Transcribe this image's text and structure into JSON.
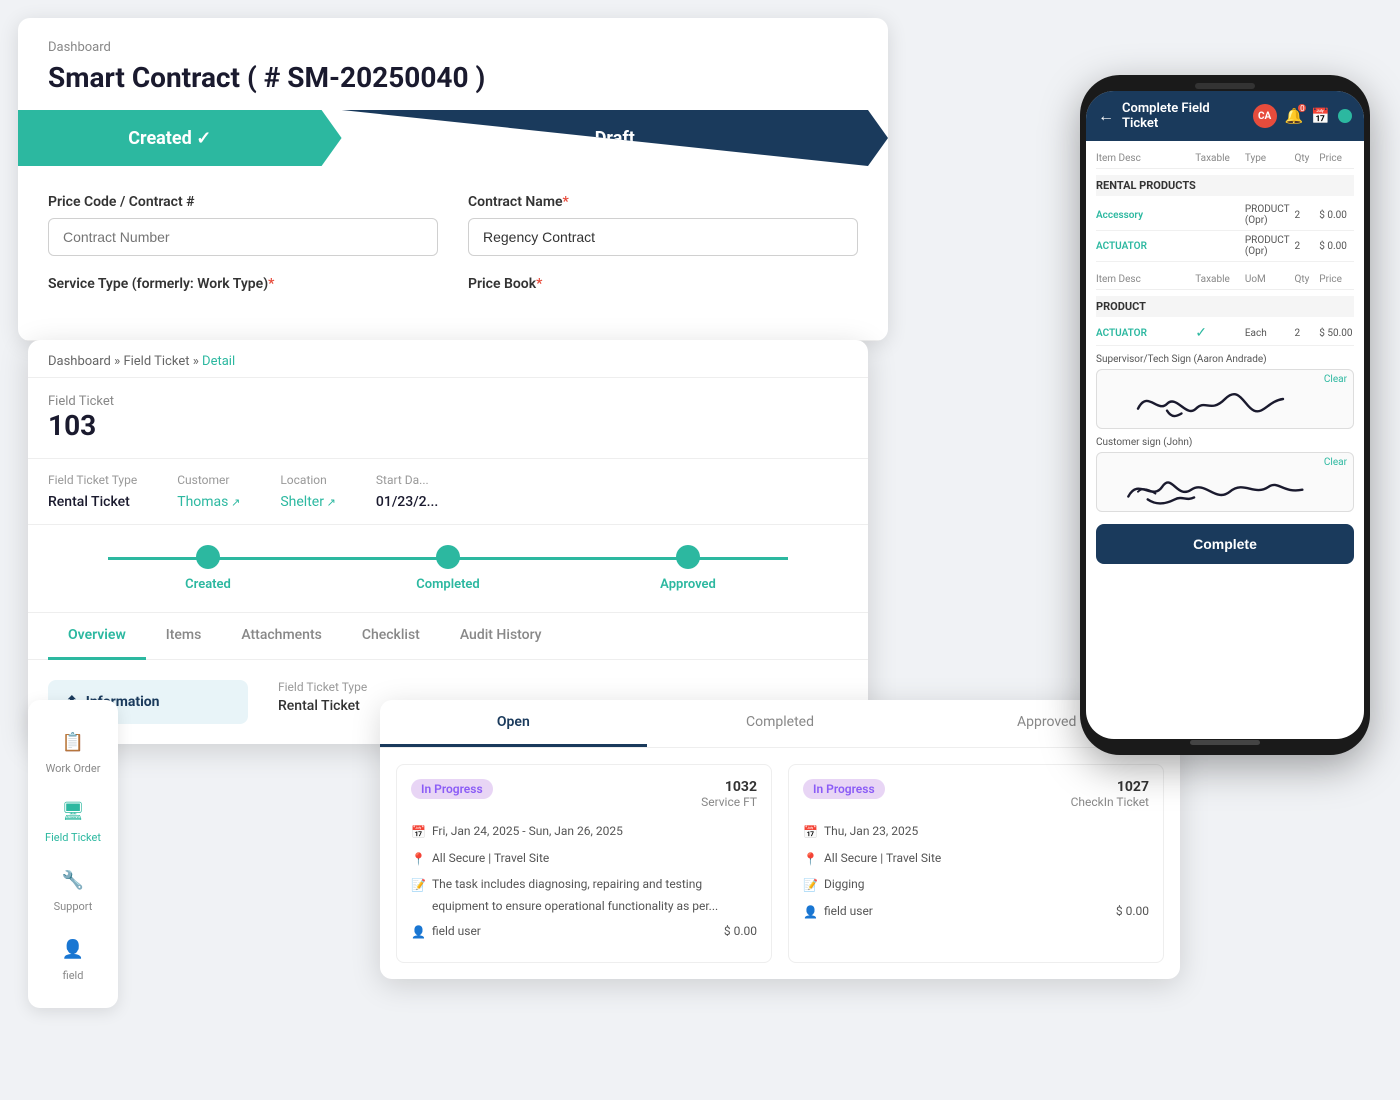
{
  "breadcrumb": "Dashboard",
  "page_title": "Smart Contract ( # SM-20250040 )",
  "status_bar": {
    "created_label": "Created ✓",
    "draft_label": "Draft"
  },
  "form": {
    "price_code_label": "Price Code / Contract #",
    "contract_number_placeholder": "Contract Number",
    "contract_name_label": "Contract Name",
    "contract_name_value": "Regency Contract",
    "service_type_label": "Service Type (formerly: Work Type)",
    "price_book_label": "Price Book"
  },
  "field_ticket": {
    "breadcrumb_dashboard": "Dashboard",
    "breadcrumb_field_ticket": "Field Ticket",
    "breadcrumb_detail": "Detail",
    "label": "Field Ticket",
    "number": "103",
    "type_label": "Field Ticket Type",
    "type_value": "Rental Ticket",
    "customer_label": "Customer",
    "customer_value": "Thomas",
    "location_label": "Location",
    "location_value": "Shelter",
    "start_date_label": "Start Da...",
    "start_date_value": "01/23/2...",
    "progress_steps": [
      "Created",
      "Completed",
      "Approved"
    ],
    "tabs": [
      "Overview",
      "Items",
      "Attachments",
      "Checklist",
      "Audit History"
    ]
  },
  "info_section": {
    "title": "Information",
    "field_ticket_type_label": "Field Ticket Type",
    "field_ticket_type_value": "Rental Ticket"
  },
  "sidebar": {
    "items": [
      {
        "label": "Work Order",
        "icon": "📋"
      },
      {
        "label": "Field Ticket",
        "icon": "🖥"
      },
      {
        "label": "Support",
        "icon": "🔧"
      },
      {
        "label": "field",
        "icon": "👤"
      }
    ]
  },
  "work_order": {
    "tabs": [
      "Open",
      "Completed",
      "Approved"
    ],
    "active_tab": "Open",
    "cards": [
      {
        "badge": "In Progress",
        "ticket_num": "1032",
        "ticket_type": "Service FT",
        "date_range": "Fri, Jan 24, 2025 - Sun, Jan 26, 2025",
        "location": "All Secure | Travel Site",
        "description": "The task includes diagnosing, repairing and testing equipment to ensure operational functionality as per...",
        "user": "field user",
        "amount": "$ 0.00"
      },
      {
        "badge": "In Progress",
        "ticket_num": "1027",
        "ticket_type": "CheckIn Ticket",
        "date": "Thu, Jan 23, 2025",
        "location": "All Secure | Travel Site",
        "description": "Digging",
        "user": "field user",
        "amount": "$ 0.00"
      }
    ]
  },
  "phone": {
    "header_title": "Complete Field Ticket",
    "avatar": "CA",
    "table_headers": [
      "Item Desc",
      "Taxable",
      "Type",
      "Qty",
      "Price"
    ],
    "rental_products_title": "RENTAL PRODUCTS",
    "rental_rows": [
      {
        "item": "Accessory",
        "taxable": "",
        "type": "PRODUCT (Opr)",
        "qty": "2",
        "price": "$ 0.00"
      },
      {
        "item": "ACTUATOR",
        "taxable": "",
        "type": "PRODUCT (Opr)",
        "qty": "2",
        "price": "$ 0.00"
      }
    ],
    "product_headers": [
      "Item Desc",
      "Taxable",
      "UoM",
      "Qty",
      "Price"
    ],
    "product_title": "PRODUCT",
    "product_rows": [
      {
        "item": "ACTUATOR",
        "taxable": "✓",
        "uom": "Each",
        "qty": "2",
        "price": "$ 50.00"
      }
    ],
    "supervisor_sign_label": "Supervisor/Tech Sign (Aaron Andrade)",
    "customer_sign_label": "Customer sign (John)",
    "clear_label": "Clear",
    "complete_label": "Complete"
  }
}
